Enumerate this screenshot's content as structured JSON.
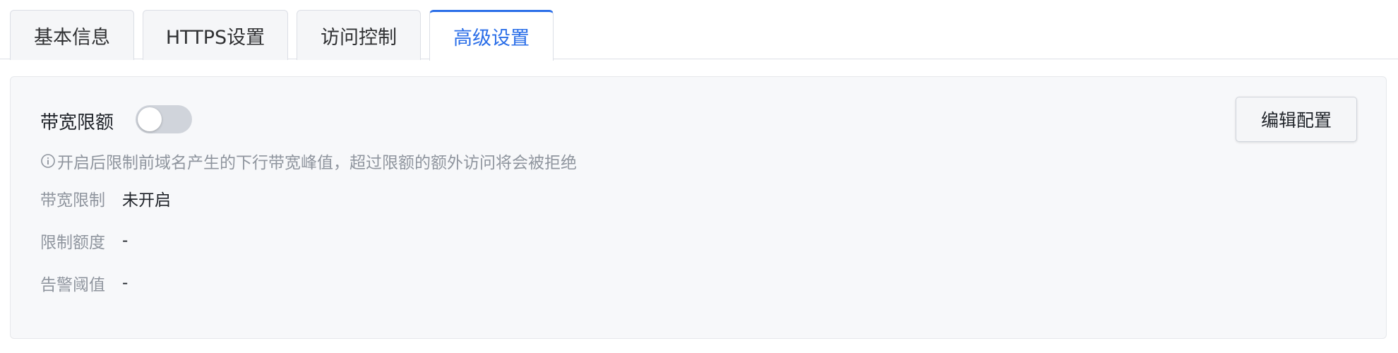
{
  "tabs": [
    {
      "label": "基本信息"
    },
    {
      "label": "HTTPS设置"
    },
    {
      "label": "访问控制"
    },
    {
      "label": "高级设置"
    }
  ],
  "bandwidth": {
    "title": "带宽限额",
    "toggle_on": false,
    "hint_icon": "info-circle-icon",
    "hint": "开启后限制前域名产生的下行带宽峰值，超过限额的额外访问将会被拒绝",
    "edit_label": "编辑配置",
    "rows": [
      {
        "label": "带宽限制",
        "value": "未开启"
      },
      {
        "label": "限制额度",
        "value": "-"
      },
      {
        "label": "告警阈值",
        "value": "-"
      }
    ]
  },
  "colors": {
    "accent": "#2a6ee8",
    "toggle_off": "#d0d4db",
    "muted_text": "#8f959e",
    "panel_bg": "#f7f8fa"
  }
}
